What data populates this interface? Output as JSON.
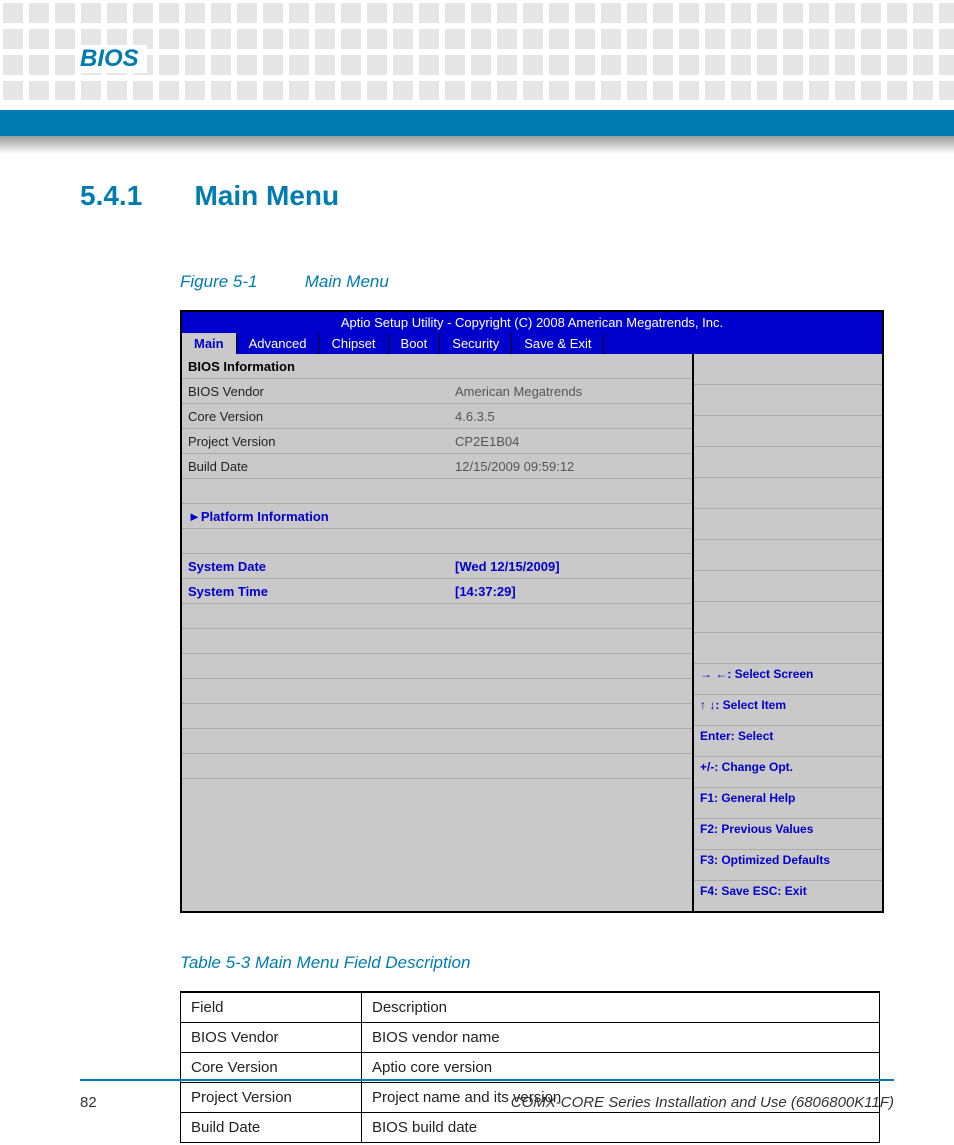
{
  "header": {
    "section_label": "BIOS"
  },
  "section": {
    "number": "5.4.1",
    "title": "Main Menu"
  },
  "figure": {
    "label": "Figure 5-1",
    "title": "Main Menu"
  },
  "bios": {
    "title_bar": "Aptio Setup Utility - Copyright (C) 2008 American Megatrends, Inc.",
    "tabs": [
      "Main",
      "Advanced",
      "Chipset",
      "Boot",
      "Security",
      "Save & Exit"
    ],
    "active_tab": "Main",
    "info_header": "BIOS Information",
    "rows": [
      {
        "label": "BIOS Vendor",
        "value": "American Megatrends"
      },
      {
        "label": "Core Version",
        "value": "4.6.3.5"
      },
      {
        "label": "Project Version",
        "value": "CP2E1B04"
      },
      {
        "label": "Build Date",
        "value": "12/15/2009 09:59:12"
      }
    ],
    "submenu": {
      "arrow": "►",
      "label": "Platform Information"
    },
    "system_date": {
      "label": "System Date",
      "value": "[Wed 12/15/2009]"
    },
    "system_time": {
      "label": "System Time",
      "value": "[14:37:29]"
    },
    "help": {
      "select_screen": "→ ←: Select Screen",
      "select_item": "↑ ↓: Select Item",
      "enter": "Enter: Select",
      "change": "+/-: Change Opt.",
      "f1": "F1: General Help",
      "f2": "F2: Previous Values",
      "f3": "F3: Optimized Defaults",
      "f4": "F4: Save   ESC: Exit"
    }
  },
  "table": {
    "caption": "Table 5-3 Main Menu Field Description",
    "headers": {
      "field": "Field",
      "desc": "Description"
    },
    "rows": [
      {
        "field": "BIOS Vendor",
        "desc": "BIOS vendor name"
      },
      {
        "field": "Core Version",
        "desc": "Aptio core version"
      },
      {
        "field": "Project Version",
        "desc": "Project name and its version"
      },
      {
        "field": "Build Date",
        "desc": "BIOS build date"
      }
    ]
  },
  "footer": {
    "page": "82",
    "doc": "COMX-CORE Series Installation and Use (6806800K11F)"
  }
}
